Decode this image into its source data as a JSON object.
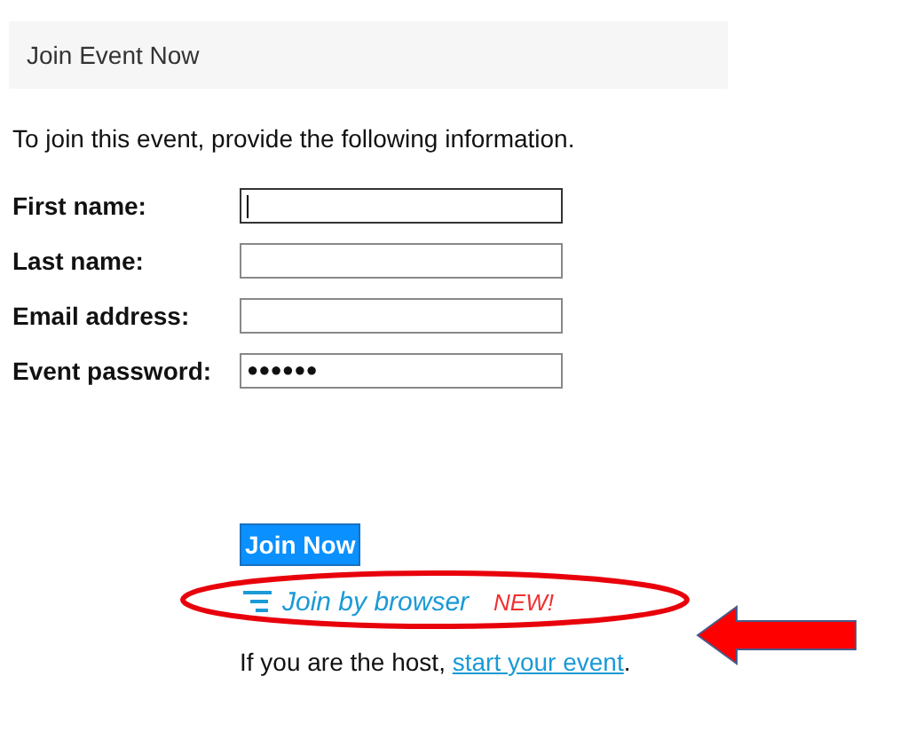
{
  "header": {
    "title": "Join Event Now"
  },
  "intro": "To join this event, provide the following information.",
  "fields": [
    {
      "label": "First name:",
      "focused": true
    },
    {
      "label": "Last name:",
      "focused": false
    },
    {
      "label": "Email address:",
      "focused": false
    },
    {
      "label": "Event password:",
      "value": "●●●●●●",
      "focused": false
    }
  ],
  "join_button": "Join Now",
  "browser_link": {
    "label": "Join by browser",
    "badge": "NEW!"
  },
  "host_note": {
    "text": "If you are the host, ",
    "link": "start your event",
    "suffix": "."
  }
}
